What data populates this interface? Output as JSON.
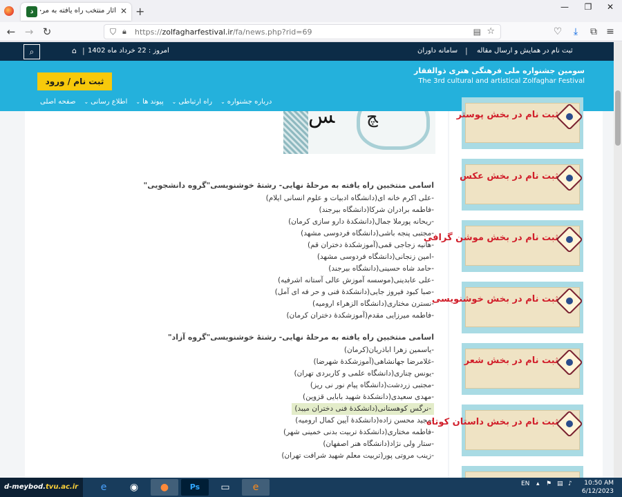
{
  "browser": {
    "tab_title": "آثار منتخب راه یافته به مرحله نهایی",
    "url_prefix": "https://",
    "url_host": "zolfagharfestival.ir",
    "url_path": "/fa/news.php?rid=69",
    "new_tab": "+"
  },
  "site": {
    "search_icon": "search-icon",
    "date_label": "امروز : 22 خرداد ماه 1402",
    "top_links": [
      "ثبت نام در همایش و ارسال مقاله",
      "سامانه داوران"
    ],
    "register_button": "ثبت نام / ورود",
    "fest_fa": "سومین جشنواره ملی فرهنگی هنری ذوالفقار",
    "fest_en": "The 3rd cultural and artistical Zolfaghar Festival",
    "menu": [
      "صفحه اصلی",
      "اطلاع رسانی",
      "پیوند ها",
      "راه ارتباطی",
      "درباره جشنواره"
    ]
  },
  "groups": [
    {
      "title": "اسامی منتخبین راه یافته به مرحلهٔ نهایی- رشتهٔ خوشنویسی\"گروه دانشجویی\"",
      "entries": [
        "-علی اکرم خانه ای(دانشگاه ادبیات و علوم انسانی ایلام)",
        "-فاطمه برادران شرکا(دانشگاه بیرجند)",
        "-ریحانه پورملا جمال(دانشکدهٔ دارو سازی کرمان)",
        "-مجتبی پنجه باشی(دانشگاه فردوسی مشهد)",
        "-هانیه زجاجی قمی(آموزشکدهٔ دختران قم)",
        "-امین زنجانی(دانشگاه فردوسی مشهد)",
        "-حامد شاه حسینی(دانشگاه بیرجند)",
        "-علی عابدینی(موسسه آموزش عالی آستانه اشرفیه)",
        "-صبا کبود فیروز جایی(دانشکدهٔ فنی و حر فه ای آمل)",
        "-نسترن مختاری(دانشگاه الزهراء ارومیه)",
        "-فاطمه میرزایی مقدم(آموزشکدهٔ دختران کرمان)"
      ]
    },
    {
      "title": "اسامی منتخبین راه یافته به مرحلهٔ نهایی- رشتهٔ خوشنویسی\"گروه آزاد\"",
      "entries": [
        "-یاسمین زهرا اباذریان(کرمان)",
        "-غلامرضا جهانشاهی(آموزشکدهٔ شهرضا)",
        "-یونس چناری(دانشگاه علمی و کاربردی تهران)",
        "-مجتبی زردشت(دانشگاه پیام نور نی ریز)",
        "-مهدی سعیدی(دانشکدهٔ شهید بابایی قزوین)",
        "-نرگس کوهستانی(دانشکدهٔ فنی دختران میبد)",
        "-مجید محسن زاده(دانشکدهٔ آیین کمال ارومیه)",
        "-فاطمه مختاری(دانشکدهٔ تربیت بدنی خمینی شهر)",
        "-ستار ولی نژاد(دانشگاه هنر اصفهان)",
        "-زینب مروتی پور(تربیت معلم شهید شرافت تهران)"
      ]
    }
  ],
  "highlighted_entry_index": 5,
  "sidebar_cards": [
    "ثبت نام در بخش پوستر",
    "ثبت نام در بخش عکس",
    "ثبت نام در بخش موشن گرافی",
    "ثبت نام در بخش خوشنویسی",
    "ثبت نام در بخش شعر",
    "ثبت نام در بخش داستان کوتاه"
  ],
  "taskbar": {
    "logo_main": "d-meybod.",
    "logo_accent": "tvu.ac.ir",
    "lang": "EN",
    "time": "10:50 AM",
    "date": "6/12/2023"
  },
  "colors": {
    "topbar": "#0c2c47",
    "header": "#24b1dc",
    "register": "#f7c90b",
    "card_text": "#d11f2b"
  }
}
